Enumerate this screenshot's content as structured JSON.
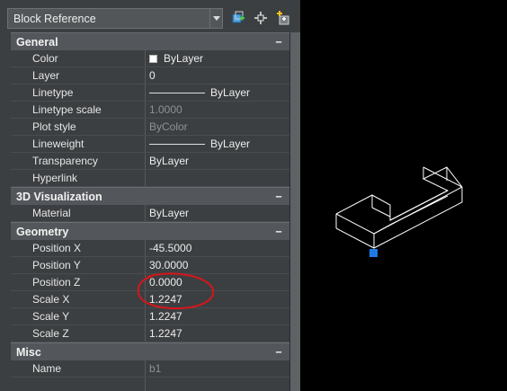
{
  "selector": {
    "value": "Block Reference"
  },
  "toolbar": {
    "icons": [
      "quick-select-icon",
      "select-objects-icon",
      "toggle-pickadd-icon"
    ]
  },
  "sections": {
    "general": {
      "title": "General",
      "toggle": "−",
      "color": {
        "label": "Color",
        "value": "ByLayer"
      },
      "layer": {
        "label": "Layer",
        "value": "0"
      },
      "linetype": {
        "label": "Linetype",
        "value": "ByLayer"
      },
      "linetype_scale": {
        "label": "Linetype scale",
        "value": "1.0000"
      },
      "plot_style": {
        "label": "Plot style",
        "value": "ByColor"
      },
      "lineweight": {
        "label": "Lineweight",
        "value": "ByLayer"
      },
      "transparency": {
        "label": "Transparency",
        "value": "ByLayer"
      },
      "hyperlink": {
        "label": "Hyperlink",
        "value": ""
      }
    },
    "visualization": {
      "title": "3D Visualization",
      "toggle": "−",
      "material": {
        "label": "Material",
        "value": "ByLayer"
      }
    },
    "geometry": {
      "title": "Geometry",
      "toggle": "−",
      "position_x": {
        "label": "Position X",
        "value": "-45.5000"
      },
      "position_y": {
        "label": "Position Y",
        "value": "30.0000"
      },
      "position_z": {
        "label": "Position Z",
        "value": "0.0000"
      },
      "scale_x": {
        "label": "Scale X",
        "value": "1.2247"
      },
      "scale_y": {
        "label": "Scale Y",
        "value": "1.2247"
      },
      "scale_z": {
        "label": "Scale Z",
        "value": "1.2247"
      }
    },
    "misc": {
      "title": "Misc",
      "toggle": "−",
      "name": {
        "label": "Name",
        "value": "b1"
      }
    }
  },
  "colors": {
    "panel_bg": "#3c3f41",
    "section_bg": "#53575b",
    "annotation": "#d6161c",
    "grip": "#1e7be6",
    "wireframe": "#ffffff"
  }
}
